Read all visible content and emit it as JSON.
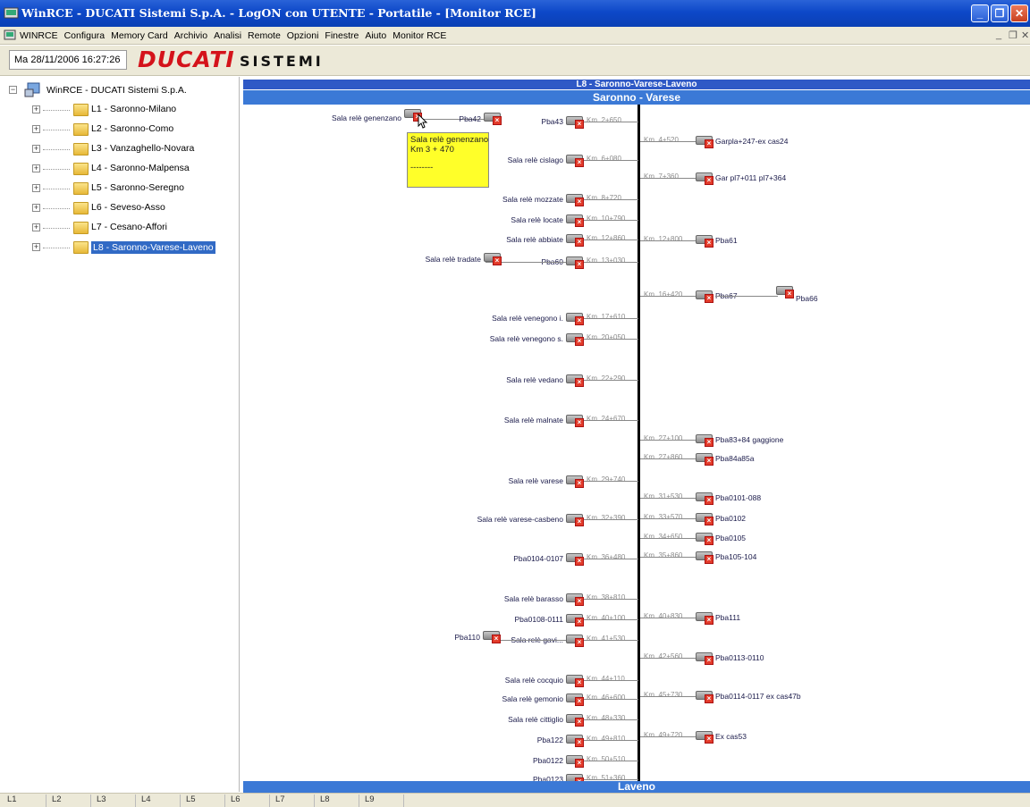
{
  "window": {
    "title": "WinRCE  -  DUCATI Sistemi S.p.A.  - LogON con UTENTE  - Portatile - [Monitor RCE]",
    "buttons": {
      "minimize": "_",
      "restore": "❐",
      "close": "✕"
    }
  },
  "menu": {
    "items": [
      "WINRCE",
      "Configura",
      "Memory Card",
      "Archivio",
      "Analisi",
      "Remote",
      "Opzioni",
      "Finestre",
      "Aiuto",
      "Monitor RCE"
    ],
    "mdi_buttons": {
      "minimize": "_",
      "restore": "❐",
      "close": "✕"
    }
  },
  "toolbar": {
    "datetime": "Ma 28/11/2006 16:27:26",
    "logo_main": "DUCATI",
    "logo_sub": "SISTEMI"
  },
  "tree": {
    "root": "WinRCE  - DUCATI Sistemi S.p.A.",
    "items": [
      {
        "label": "L1 - Saronno-Milano"
      },
      {
        "label": "L2 - Saronno-Como"
      },
      {
        "label": "L3 - Vanzaghello-Novara"
      },
      {
        "label": "L4 - Saronno-Malpensa"
      },
      {
        "label": "L5 - Saronno-Seregno"
      },
      {
        "label": "L6 - Seveso-Asso"
      },
      {
        "label": "L7 - Cesano-Affori"
      },
      {
        "label": "L8 - Saronno-Varese-Laveno"
      }
    ],
    "selected_index": 7
  },
  "diagram": {
    "line_title": "L8 - Saronno-Varese-Laveno",
    "section_top": "Saronno - Varese",
    "section_bottom": "Laveno",
    "tooltip": {
      "line1": "Sala relè genenzano",
      "line2": "Km 3 + 470",
      "line3": "--------"
    },
    "left_extra": [
      {
        "label": "Sala relè genenzano"
      },
      {
        "label": "Pba42"
      },
      {
        "label": "Sala relè tradate"
      },
      {
        "label": "Pba110"
      }
    ],
    "left": [
      {
        "label": "Pba43",
        "km": "Km.  2+650"
      },
      {
        "label": "Sala relè cislago",
        "km": "Km.  6+080"
      },
      {
        "label": "Sala relè mozzate",
        "km": "Km.  8+720"
      },
      {
        "label": "Sala relè locate",
        "km": "Km.  10+790"
      },
      {
        "label": "Sala relè abbiate",
        "km": "Km.  12+860"
      },
      {
        "label": "Pba60",
        "km": "Km.  13+030"
      },
      {
        "label": "Sala relè venegono i.",
        "km": "Km.  17+610"
      },
      {
        "label": "Sala relè venegono s.",
        "km": "Km.  20+050"
      },
      {
        "label": "Sala relè vedano",
        "km": "Km.  22+290"
      },
      {
        "label": "Sala relè malnate",
        "km": "Km.  24+670"
      },
      {
        "label": "Sala relè varese",
        "km": "Km.  29+740"
      },
      {
        "label": "Sala relè varese-casbeno",
        "km": "Km.  32+390"
      },
      {
        "label": "Pba0104-0107",
        "km": "Km.  36+480"
      },
      {
        "label": "Sala relè barasso",
        "km": "Km.  38+810"
      },
      {
        "label": "Pba0108-0111",
        "km": "Km.  40+100"
      },
      {
        "label": "Sala relè gavi...",
        "km": "Km.  41+530"
      },
      {
        "label": "Sala relè cocquio",
        "km": "Km.  44+110"
      },
      {
        "label": "Sala relè gemonio",
        "km": "Km.  46+600"
      },
      {
        "label": "Sala relè cittiglio",
        "km": "Km.  48+330"
      },
      {
        "label": "Pba122",
        "km": "Km.  49+810"
      },
      {
        "label": "Pba0122",
        "km": "Km.  50+510"
      },
      {
        "label": "Pba0123",
        "km": "Km.  51+360"
      }
    ],
    "right": [
      {
        "label": "Garpla+247-ex cas24",
        "km": "Km.  4+520"
      },
      {
        "label": "Gar pl7+011 pl7+364",
        "km": "Km.  7+360"
      },
      {
        "label": "Pba61",
        "km": "Km.  12+800"
      },
      {
        "label": "Pba67",
        "km": "Km.  16+420"
      },
      {
        "label": "Pba83+84 gaggione",
        "km": "Km.  27+100"
      },
      {
        "label": "Pba84a85a",
        "km": "Km.  27+860"
      },
      {
        "label": "Pba0101-088",
        "km": "Km.  31+530"
      },
      {
        "label": "Pba0102",
        "km": "Km.  33+570"
      },
      {
        "label": "Pba0105",
        "km": "Km.  34+650"
      },
      {
        "label": "Pba105-104",
        "km": "Km.  35+860"
      },
      {
        "label": "Pba111",
        "km": "Km.  40+830"
      },
      {
        "label": "Pba0113-0110",
        "km": "Km.  42+560"
      },
      {
        "label": "Pba0114-0117 ex cas47b",
        "km": "Km.  45+730"
      },
      {
        "label": "Ex cas53",
        "km": "Km.  49+720"
      }
    ],
    "right_extra": [
      {
        "label": "Pba66"
      }
    ]
  },
  "statusbar": {
    "tabs": [
      "L1",
      "L2",
      "L3",
      "L4",
      "L5",
      "L6",
      "L7",
      "L8",
      "L9"
    ]
  }
}
